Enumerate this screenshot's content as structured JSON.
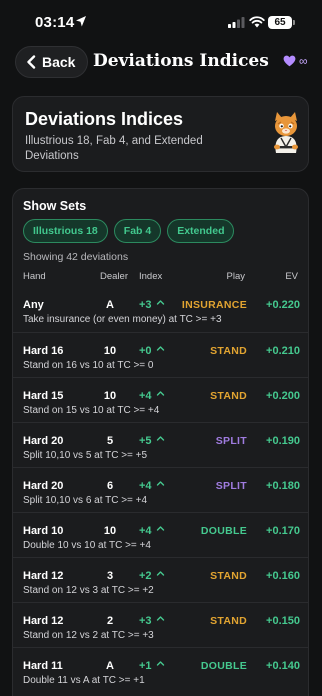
{
  "status_bar": {
    "time": "03:14",
    "battery": "65"
  },
  "nav": {
    "back_label": "Back",
    "title": "Deviations Indices",
    "badge_symbol": "∞"
  },
  "header": {
    "title": "Deviations Indices",
    "subtitle": "Illustrious 18, Fab 4, and Extended Deviations"
  },
  "sets": {
    "title": "Show Sets",
    "chips": [
      "Illustrious 18",
      "Fab 4",
      "Extended"
    ],
    "showing": "Showing 42 deviations"
  },
  "table": {
    "columns": {
      "hand": "Hand",
      "dealer": "Dealer",
      "index": "Index",
      "play": "Play",
      "ev": "EV"
    },
    "rows": [
      {
        "hand": "Any",
        "dealer": "A",
        "index": "+3",
        "play": "INSURANCE",
        "ev": "+0.220",
        "desc": "Take insurance (or even money) at TC >= +3"
      },
      {
        "hand": "Hard 16",
        "dealer": "10",
        "index": "+0",
        "play": "STAND",
        "ev": "+0.210",
        "desc": "Stand on 16 vs 10 at TC >= 0"
      },
      {
        "hand": "Hard 15",
        "dealer": "10",
        "index": "+4",
        "play": "STAND",
        "ev": "+0.200",
        "desc": "Stand on 15 vs 10 at TC >= +4"
      },
      {
        "hand": "Hard 20",
        "dealer": "5",
        "index": "+5",
        "play": "SPLIT",
        "ev": "+0.190",
        "desc": "Split 10,10 vs 5 at TC >= +5"
      },
      {
        "hand": "Hard 20",
        "dealer": "6",
        "index": "+4",
        "play": "SPLIT",
        "ev": "+0.180",
        "desc": "Split 10,10 vs 6 at TC >= +4"
      },
      {
        "hand": "Hard 10",
        "dealer": "10",
        "index": "+4",
        "play": "DOUBLE",
        "ev": "+0.170",
        "desc": "Double 10 vs 10 at TC >= +4"
      },
      {
        "hand": "Hard 12",
        "dealer": "3",
        "index": "+2",
        "play": "STAND",
        "ev": "+0.160",
        "desc": "Stand on 12 vs 3 at TC >= +2"
      },
      {
        "hand": "Hard 12",
        "dealer": "2",
        "index": "+3",
        "play": "STAND",
        "ev": "+0.150",
        "desc": "Stand on 12 vs 2 at TC >= +3"
      },
      {
        "hand": "Hard 11",
        "dealer": "A",
        "index": "+1",
        "play": "DOUBLE",
        "ev": "+0.140",
        "desc": "Double 11 vs A at TC >= +1"
      }
    ]
  },
  "colors": {
    "background": "#111213",
    "card": "#1b1c1e",
    "accent_green": "#45c98f",
    "insurance": "#e2a431",
    "stand": "#e2a431",
    "split": "#a07ce0",
    "double": "#45c98f",
    "premium": "#b48cff"
  },
  "icons": {
    "location": "location-arrow-icon",
    "signal": "cellular-signal-icon",
    "wifi": "wifi-icon",
    "back": "chevron-left-icon",
    "premium": "heart-icon",
    "mascot": "cat-mascot-icon",
    "index_trend": "chevron-up-icon"
  }
}
